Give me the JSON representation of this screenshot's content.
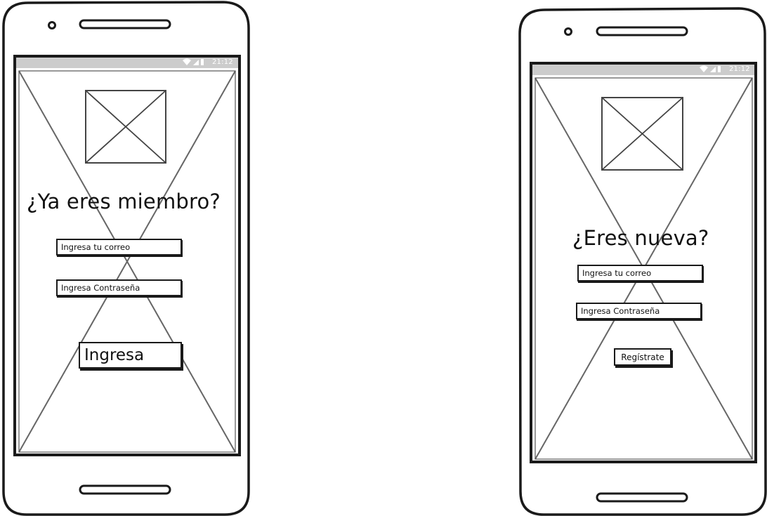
{
  "status_bar": {
    "time": "21:12"
  },
  "screen_login": {
    "title": "¿Ya eres miembro?",
    "email_placeholder": "Ingresa tu correo",
    "password_placeholder": "Ingresa Contraseña",
    "submit_label": "Ingresa"
  },
  "screen_signup": {
    "title": "¿Eres nueva?",
    "email_placeholder": "Ingresa tu correo",
    "password_placeholder": "Ingresa Contraseña",
    "submit_label": "Regístrate"
  },
  "colors": {
    "ink": "#1a1a1a",
    "status_bar": "#cccccc",
    "placeholder_cross": "#666666"
  },
  "icons": [
    "wifi-icon",
    "signal-icon",
    "battery-icon",
    "image-placeholder-icon"
  ]
}
